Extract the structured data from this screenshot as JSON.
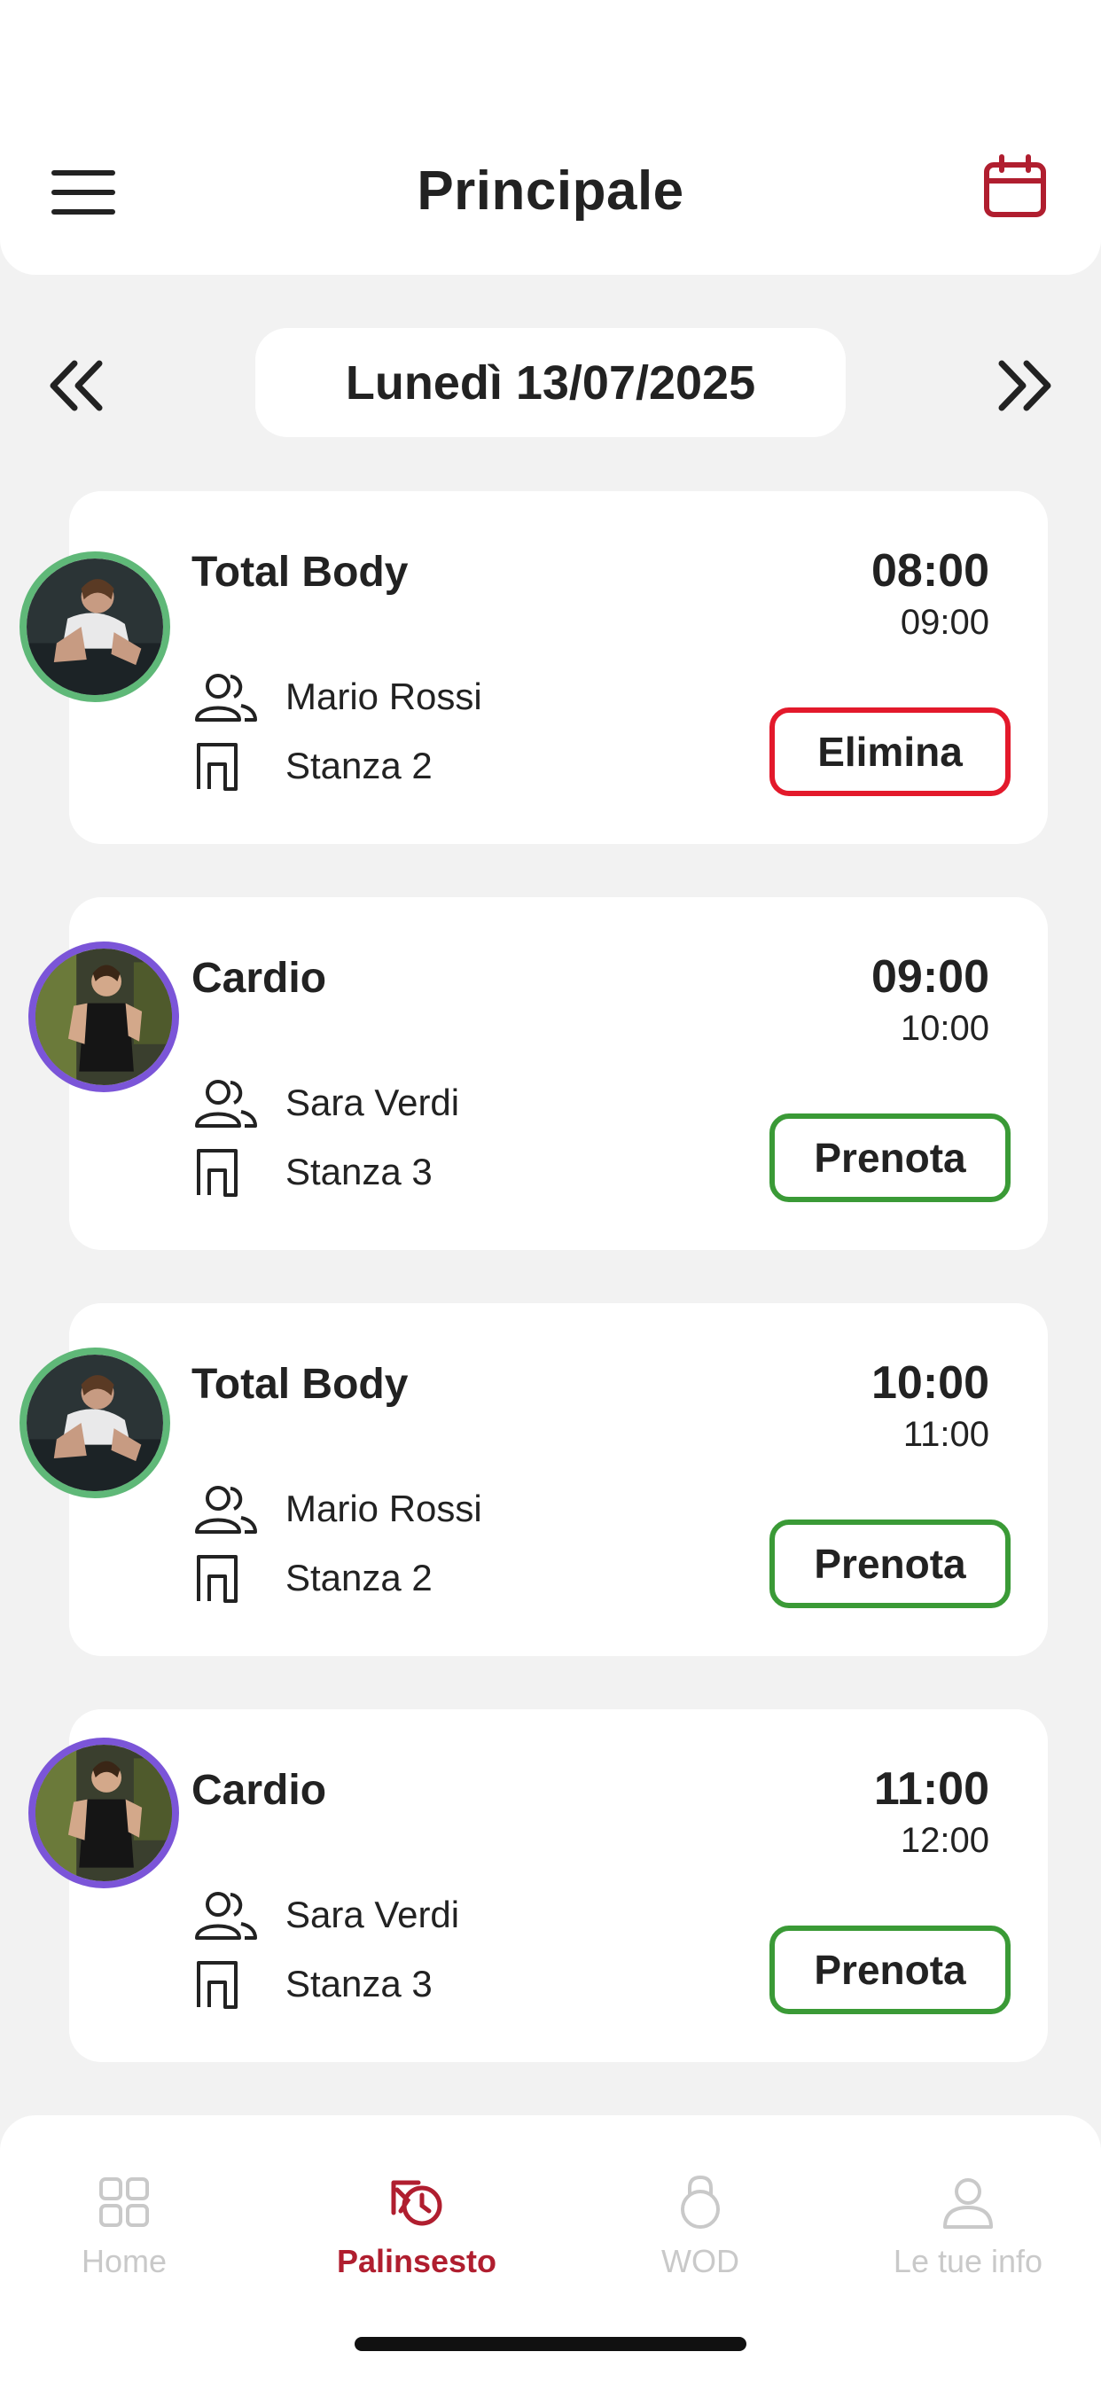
{
  "header": {
    "title": "Principale",
    "menu_icon": "hamburger-menu-icon",
    "calendar_icon": "calendar-icon",
    "accent": "#b01e2f"
  },
  "date_nav": {
    "date_label": "Lunedì 13/07/2025",
    "prev_icon": "double-chevron-left-icon",
    "next_icon": "double-chevron-right-icon"
  },
  "classes": [
    {
      "name": "Total Body",
      "start": "08:00",
      "end": "09:00",
      "trainer": "Mario Rossi",
      "room": "Stanza 2",
      "action": "Elimina",
      "ring_color": "#5fb878",
      "action_color": "#e3192b"
    },
    {
      "name": "Cardio",
      "start": "09:00",
      "end": "10:00",
      "trainer": "Sara Verdi",
      "room": "Stanza 3",
      "action": "Prenota",
      "ring_color": "#7b55d8",
      "action_color": "#3a9a36"
    },
    {
      "name": "Total Body",
      "start": "10:00",
      "end": "11:00",
      "trainer": "Mario Rossi",
      "room": "Stanza 2",
      "action": "Prenota",
      "ring_color": "#5fb878",
      "action_color": "#3a9a36"
    },
    {
      "name": "Cardio",
      "start": "11:00",
      "end": "12:00",
      "trainer": "Sara Verdi",
      "room": "Stanza 3",
      "action": "Prenota",
      "ring_color": "#7b55d8",
      "action_color": "#3a9a36"
    }
  ],
  "tabbar": {
    "tabs": [
      {
        "label": "Home",
        "icon": "grid-icon",
        "active": false
      },
      {
        "label": "Palinsesto",
        "icon": "schedule-icon",
        "active": true
      },
      {
        "label": "WOD",
        "icon": "kettlebell-icon",
        "active": false
      },
      {
        "label": "Le tue info",
        "icon": "user-icon",
        "active": false
      }
    ]
  }
}
